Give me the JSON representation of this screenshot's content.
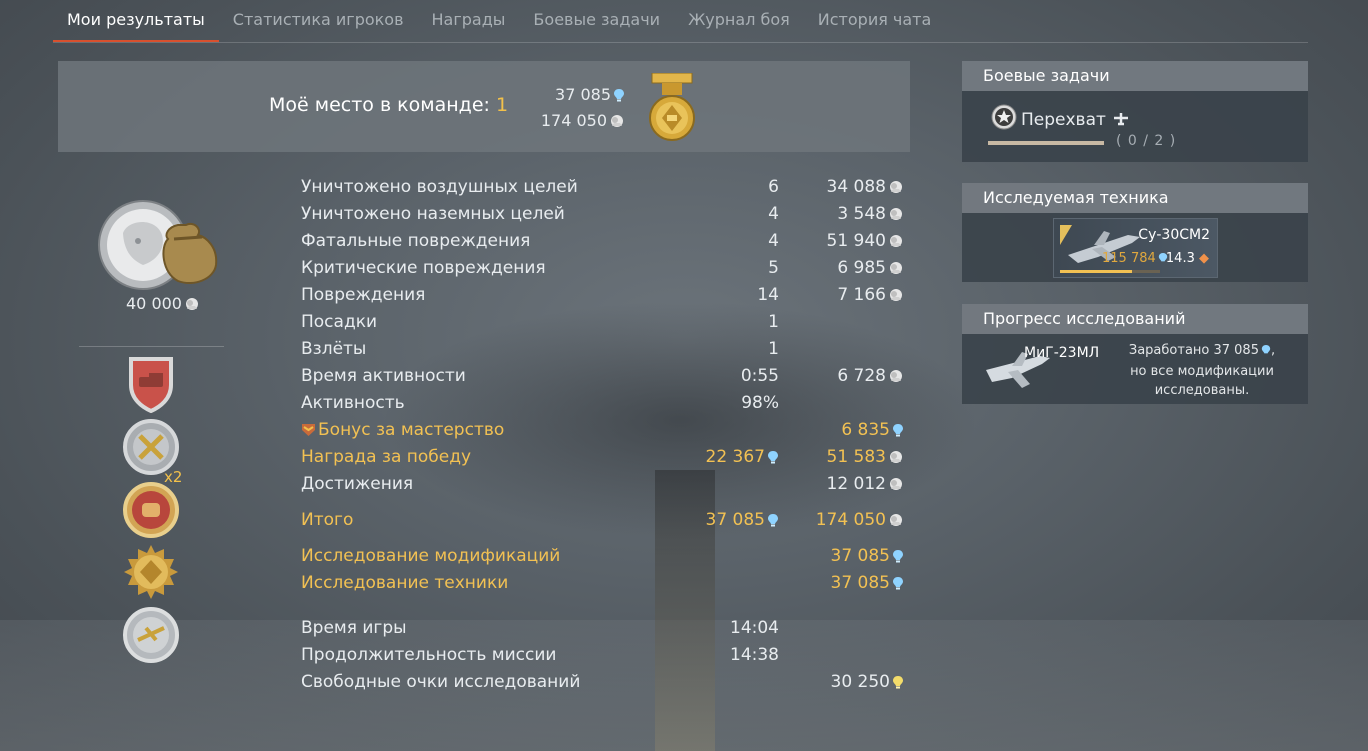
{
  "tabs": [
    {
      "label": "Мои результаты",
      "active": true
    },
    {
      "label": "Статистика игроков",
      "active": false
    },
    {
      "label": "Награды",
      "active": false
    },
    {
      "label": "Боевые задачи",
      "active": false
    },
    {
      "label": "Журнал боя",
      "active": false
    },
    {
      "label": "История чата",
      "active": false
    }
  ],
  "header": {
    "place_label": "Моё место в команде:",
    "place_value": "1",
    "rp_total": "37 085",
    "sl_total": "174 050"
  },
  "awards": {
    "main_amount": "40 000",
    "multiplier": "x2"
  },
  "stats": {
    "rows": [
      {
        "label": "Уничтожено воздушных целей",
        "v1": "6",
        "v2": "34 088"
      },
      {
        "label": "Уничтожено наземных целей",
        "v1": "4",
        "v2": "3 548"
      },
      {
        "label": "Фатальные повреждения",
        "v1": "4",
        "v2": "51 940"
      },
      {
        "label": "Критические повреждения",
        "v1": "5",
        "v2": "6 985"
      },
      {
        "label": "Повреждения",
        "v1": "14",
        "v2": "7 166"
      },
      {
        "label": "Посадки",
        "v1": "1",
        "v2": ""
      },
      {
        "label": "Взлёты",
        "v1": "1",
        "v2": ""
      },
      {
        "label": "Время активности",
        "v1": "0:55",
        "v2": "6 728"
      },
      {
        "label": "Активность",
        "v1": "98%",
        "v2": ""
      },
      {
        "label": "Бонус за мастерство",
        "v1": "",
        "v2": "6 835"
      },
      {
        "label": "Награда за победу",
        "v1": "22 367",
        "v2": "51 583"
      },
      {
        "label": "Достижения",
        "v1": "",
        "v2": "12 012"
      },
      {
        "label": "Итого",
        "v1": "37 085",
        "v2": "174 050"
      },
      {
        "label": "Исследование модификаций",
        "v1": "",
        "v2": "37 085"
      },
      {
        "label": "Исследование техники",
        "v1": "",
        "v2": "37 085"
      },
      {
        "label": "Время игры",
        "v1": "14:04",
        "v2": ""
      },
      {
        "label": "Продолжительность миссии",
        "v1": "14:38",
        "v2": ""
      },
      {
        "label": "Свободные очки исследований",
        "v1": "",
        "v2": "30 250"
      }
    ]
  },
  "battle_tasks": {
    "title": "Боевые задачи",
    "task_name": "Перехват",
    "progress": "( 0 / 2 )"
  },
  "researched_vehicle": {
    "title": "Исследуемая техника",
    "name": "Су-30СМ2",
    "rp": "115 784",
    "br": "14.3"
  },
  "research_progress": {
    "title": "Прогресс исследований",
    "vehicle": "МиГ-23МЛ",
    "note_line1": "Заработано 37 085",
    "note_line2": "но все модификации",
    "note_line3": "исследованы."
  },
  "colors": {
    "gold": "#f2c153",
    "active_tab_underline": "#d8502e",
    "rp_icon": "#8fd3ff",
    "silver_icon": "#e6e6e6",
    "free_rp_icon": "#f3dc6a"
  }
}
